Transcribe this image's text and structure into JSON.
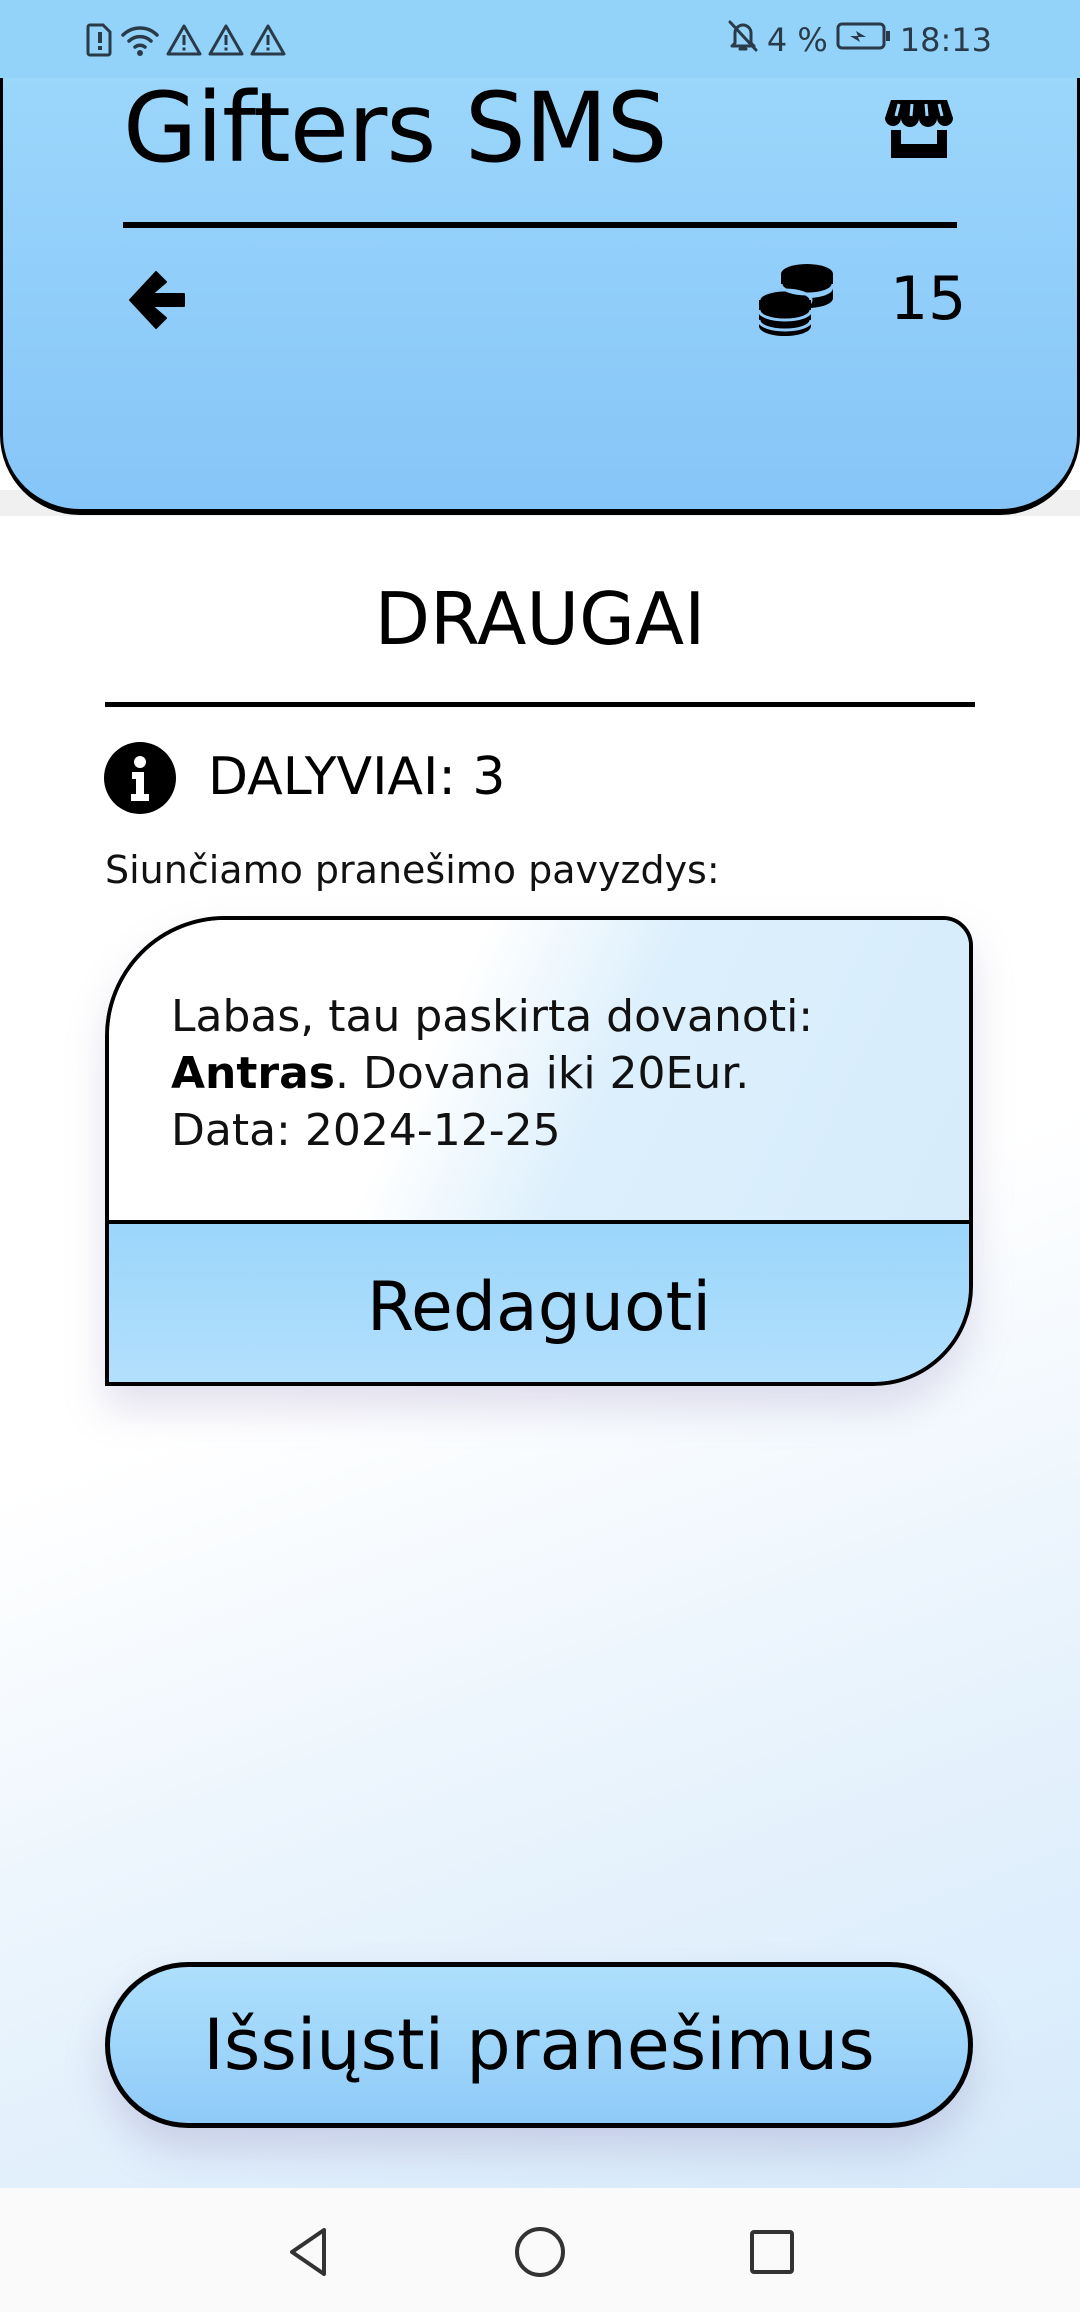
{
  "status_bar": {
    "battery_text": "4 %",
    "time": "18:13",
    "icons": [
      "sim-alert-icon",
      "wifi-icon",
      "warning-icon",
      "warning-icon",
      "warning-icon",
      "mute-icon",
      "battery-charging-icon"
    ]
  },
  "header": {
    "title": "Gifters SMS",
    "coins": "15",
    "icons": [
      "store-icon",
      "back-arrow-icon",
      "coins-icon"
    ]
  },
  "main": {
    "section_title": "DRAUGAI",
    "participants_label": "DALYVIAI: 3",
    "preview_label": "Siunčiamo pranešimo pavyzdys:",
    "message": {
      "line1": "Labas, tau paskirta dovanoti:",
      "name": "Antras",
      "line2_rest": ". Dovana iki 20Eur.",
      "line3": "Data: 2024-12-25"
    },
    "edit_button": "Redaguoti",
    "send_button": "Išsiųsti pranešimus"
  },
  "nav_bar": {
    "icons": [
      "nav-back-icon",
      "nav-home-icon",
      "nav-recent-icon"
    ]
  },
  "colors": {
    "header": "#93d3f9",
    "button": "#9bd6fb",
    "outline": "#000000"
  }
}
